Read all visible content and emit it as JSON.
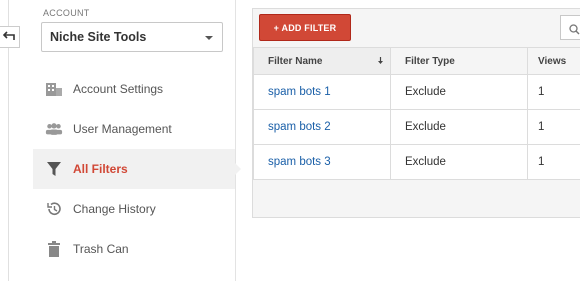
{
  "account": {
    "label": "ACCOUNT",
    "selected": "Niche Site Tools"
  },
  "nav": {
    "items": [
      {
        "label": "Account Settings",
        "icon": "building-icon"
      },
      {
        "label": "User Management",
        "icon": "users-icon"
      },
      {
        "label": "All Filters",
        "icon": "filter-icon",
        "active": true
      },
      {
        "label": "Change History",
        "icon": "history-icon"
      },
      {
        "label": "Trash Can",
        "icon": "trash-icon"
      }
    ]
  },
  "toolbar": {
    "add_filter_label": "+ ADD FILTER"
  },
  "table": {
    "headers": [
      "Filter Name",
      "Filter Type",
      "Views"
    ],
    "rows": [
      {
        "name": "spam bots 1",
        "type": "Exclude",
        "views": "1"
      },
      {
        "name": "spam bots 2",
        "type": "Exclude",
        "views": "1"
      },
      {
        "name": "spam bots 3",
        "type": "Exclude",
        "views": "1"
      }
    ]
  },
  "colors": {
    "accent": "#d14836",
    "link": "#1a5fa8"
  }
}
